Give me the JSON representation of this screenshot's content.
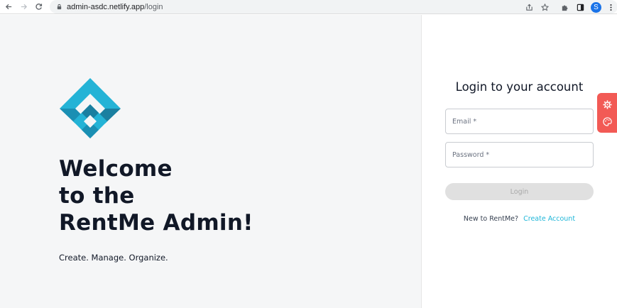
{
  "browser": {
    "url_host": "admin-asdc.netlify.app",
    "url_path": "/login",
    "profile_initial": "S"
  },
  "hero": {
    "welcome_line1": "Welcome",
    "welcome_line2": "to the",
    "welcome_line3": "RentMe Admin!",
    "tagline": "Create. Manage. Organize."
  },
  "login": {
    "title": "Login to your account",
    "email_placeholder": "Email *",
    "password_placeholder": "Password *",
    "button_label": "Login",
    "signup_prompt": "New to RentMe?",
    "signup_link": "Create Account"
  },
  "icons": {
    "back": "arrow-left-icon",
    "forward": "arrow-right-icon",
    "reload": "reload-icon",
    "lock": "lock-icon",
    "share": "share-icon",
    "bookmark": "star-icon",
    "extensions": "puzzle-icon",
    "sidepanel": "sidepanel-icon",
    "menu": "kebab-menu-icon",
    "settings": "gear-icon",
    "theme": "palette-icon"
  },
  "colors": {
    "accent": "#1fb6d8",
    "logo_light": "#24b3d6",
    "logo_dark": "#1a7fa0",
    "float_tab": "#f25a55",
    "button_disabled": "#e0e0e0",
    "left_bg": "#f5f6f7"
  }
}
